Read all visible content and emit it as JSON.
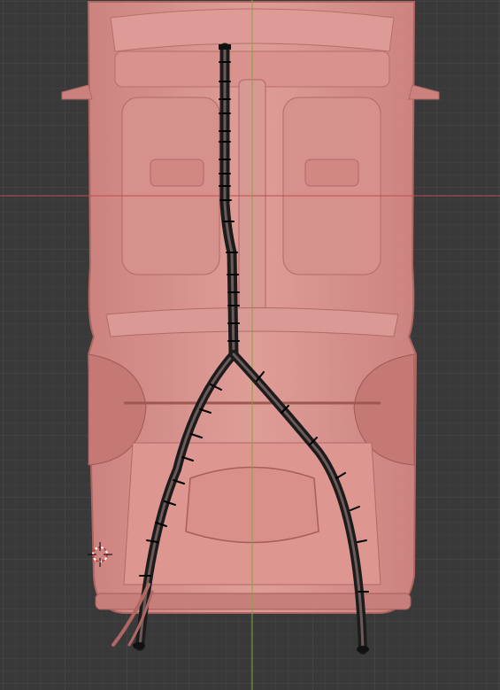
{
  "viewport": {
    "background_color": "#393939",
    "grid_minor_color": "#414141",
    "grid_major_color": "#4a4a4a",
    "x_axis_color": "#c44a52",
    "y_axis_color": "#7fa832"
  },
  "model": {
    "body_color": "#e8948f",
    "body_edge_color": "#b86a66",
    "harness_color": "#1c1c1c"
  },
  "cursor": {
    "icon": "3d-cursor-icon",
    "ring_colors": [
      "#d33c3c",
      "#ffffff"
    ]
  }
}
